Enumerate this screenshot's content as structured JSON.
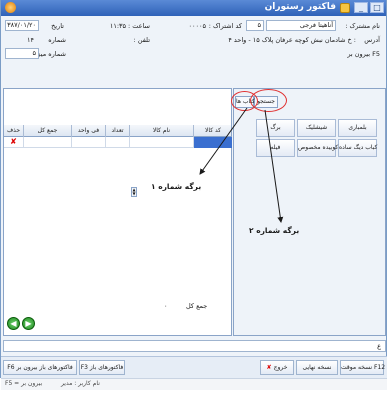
{
  "window": {
    "title": "فاکتور رستوران",
    "minimize_glyph": "_",
    "maximize_glyph": "□"
  },
  "header": {
    "customer_label": "نام مشترک :",
    "customer_value": "آناهیتا فرجی",
    "customer_code": "۵",
    "subscription_code_label": "کد اشتراک :",
    "subscription_code_value": "۰۰۰۰۵",
    "time_label": "ساعت :",
    "time_value": "۱۱:۳۵",
    "date_label": "تاریخ",
    "date_value": "۱۳۸۷/۰۱/۲۰",
    "address_label": "آدرس",
    "address_value": ": خ شادمان نبش کوچه عرفان پلاک ۱۵ - واحد ۴",
    "phone_label": "تلفن :",
    "number_label": "شماره",
    "number_value": "۱۴",
    "table_label": "شماره میز :",
    "table_value": "۵",
    "takeout_text": "F5 بیرون بر"
  },
  "grid": {
    "columns": [
      "کد کالا",
      "نام کالا",
      "تعداد",
      "فی واحد",
      "جمع کل",
      "حذف"
    ],
    "delete_glyph": "✘"
  },
  "tabs": {
    "categories": "کتاب ها",
    "search": "جستجو"
  },
  "categories": {
    "row1": [
      "بلمباری",
      "شیشلیک",
      "برگ"
    ],
    "row2": [
      "کباب دیگ ساده",
      "کوبیده مخصوص",
      "فیله"
    ]
  },
  "annotations": {
    "tab1": "برگه شماره ۱",
    "tab2": "برگه شماره ۲"
  },
  "totals": {
    "total_label": "جمع کل",
    "total_value": "۰"
  },
  "footer": {
    "temp_invoice": "نسخه موقت F12",
    "final_invoice": "نسخه نهایی",
    "exit": "خروج",
    "dine_in": "F3 فاکتورهای باز",
    "takeout_invoices": "F6 فاکتورهای باز بیرون بر"
  },
  "status": {
    "operator": "نام کاربر : مدیر",
    "takeout_hint": "F5 = بیرون بر",
    "left_marker": "ع"
  },
  "colors": {
    "annotation": "#e03030",
    "selection": "#3a6fd0",
    "title_bar": "#2f62b8"
  }
}
